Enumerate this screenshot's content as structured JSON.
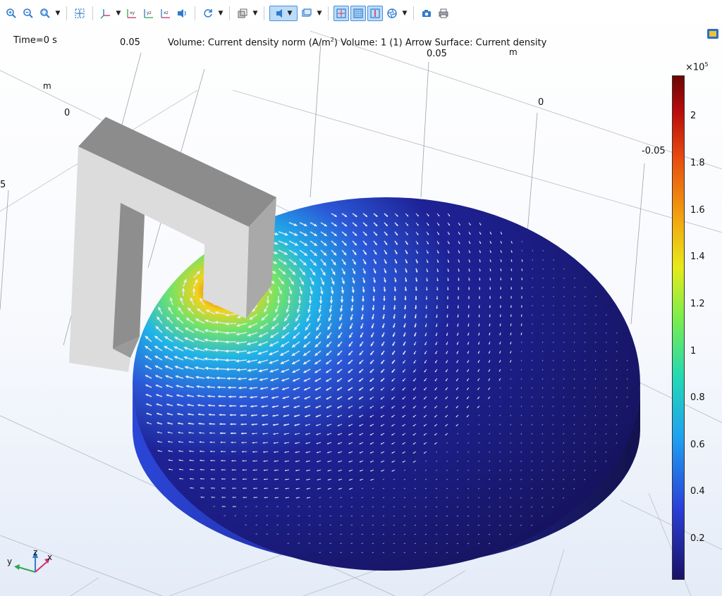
{
  "toolbar": {
    "icons": [
      "zoom-in",
      "zoom-out",
      "zoom-box",
      "zoom-extents",
      "axis-orient",
      "view-xy",
      "view-yz",
      "view-xz",
      "scene-light",
      "rotate",
      "transparency",
      "wireframe",
      "view-select",
      "grid",
      "axis",
      "coordinate-system",
      "render",
      "screenshot",
      "print"
    ],
    "active": [
      "scene-light-toggle",
      "grid-toggle",
      "axis-toggle",
      "coordinate-toggle"
    ]
  },
  "plot": {
    "time_label": "Time=0 s",
    "title_part1": "Volume: Current density norm (A/m",
    "title_sup": "2",
    "title_part2": ")  Volume: 1 (1)  Arrow Surface: Current density"
  },
  "axes": {
    "label_005_left": "0.05",
    "label_m_left": "m",
    "label_0_left": "0",
    "label_5_edge": "5",
    "label_005_right": "0.05",
    "label_m_right": "m",
    "label_0_right": "0",
    "label_neg005": "-0.05"
  },
  "colorbar": {
    "exponent_base": "×10",
    "exponent_power": "5",
    "ticks": [
      "2",
      "1.8",
      "1.6",
      "1.4",
      "1.2",
      "1",
      "0.8",
      "0.6",
      "0.4",
      "0.2"
    ],
    "colors": {
      "low": "#1a1267",
      "mid": "#22d8b6",
      "high": "#6b0606"
    }
  },
  "triad": {
    "x": "x",
    "y": "y",
    "z": "z"
  }
}
